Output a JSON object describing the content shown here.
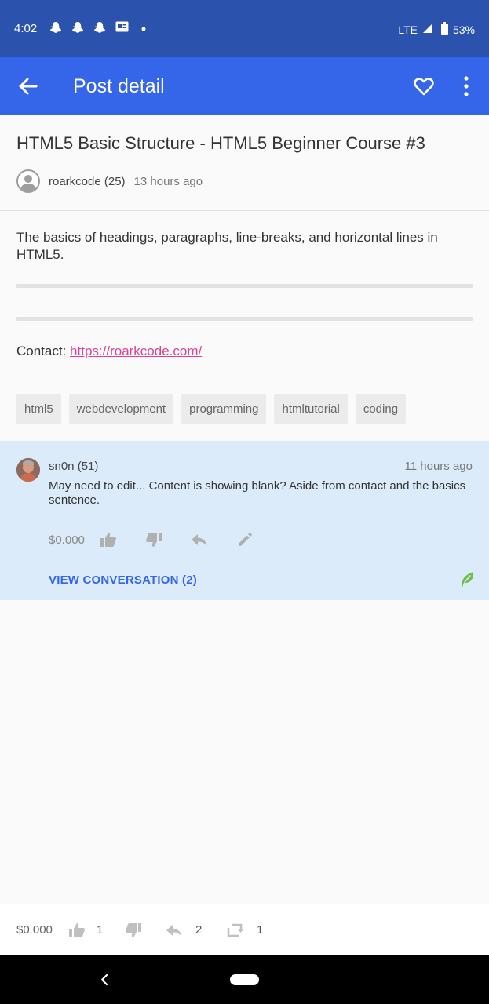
{
  "status_bar": {
    "time": "4:02",
    "notification_icons": [
      "snapchat-icon",
      "snapchat-icon",
      "snapchat-icon",
      "news-icon",
      "dot-icon"
    ],
    "network": "LTE",
    "battery": "53%"
  },
  "app_bar": {
    "title": "Post detail",
    "icons": [
      "arrow-back-icon",
      "heart-outline-icon",
      "more-vert-icon"
    ]
  },
  "post": {
    "title": "HTML5 Basic Structure - HTML5 Beginner Course #3",
    "author": "roarkcode (25)",
    "time": "13 hours ago",
    "body": "The basics of headings, paragraphs, line-breaks, and horizontal lines in HTML5.",
    "contact_label": "Contact: ",
    "contact_link": "https://roarkcode.com/",
    "tags": [
      "html5",
      "webdevelopment",
      "programming",
      "htmltutorial",
      "coding"
    ]
  },
  "comment": {
    "author": "sn0n (51)",
    "time": "11 hours ago",
    "text": "May need to edit... Content is showing blank? Aside from contact and the basics sentence.",
    "payout": "$0.000",
    "view_conversation": "VIEW CONVERSATION (2)"
  },
  "bottom_bar": {
    "payout": "$0.000",
    "upvotes": "1",
    "replies": "2",
    "reblogs": "1"
  },
  "colors": {
    "status_bar": "#2b52ad",
    "app_bar": "#3565e8",
    "link": "#e0428f",
    "comment_bg": "#dcebf9",
    "leaf": "#6cc04a"
  }
}
